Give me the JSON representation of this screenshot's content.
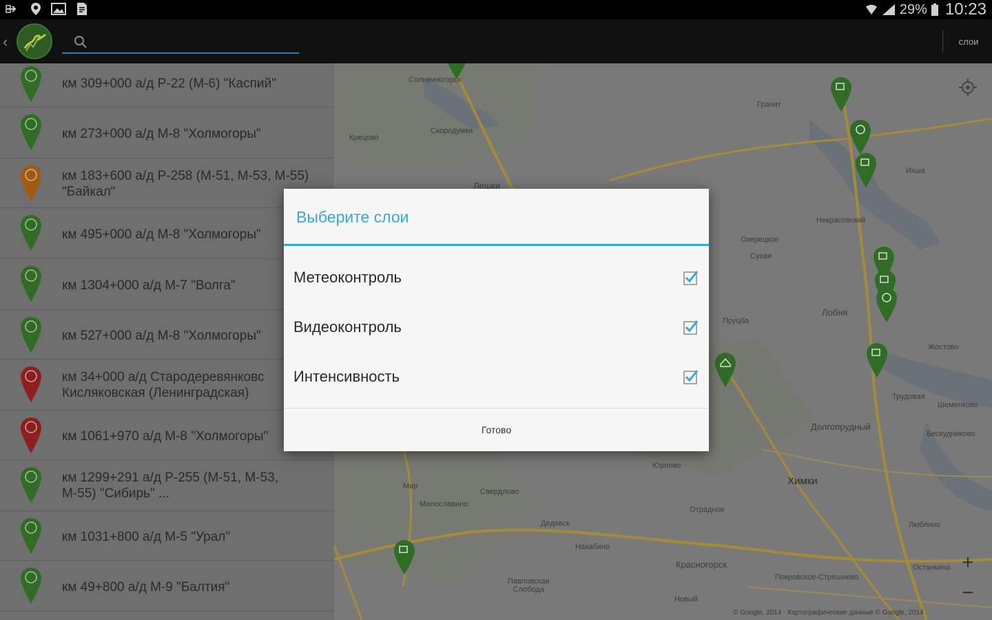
{
  "status_bar": {
    "battery_percent": "29%",
    "time": "10:23"
  },
  "action_bar": {
    "search_placeholder": "",
    "layers_label": "слои"
  },
  "list": {
    "items": [
      {
        "title": "км 309+000 а/д Р-22 (М-6) \"Каспий\"",
        "pin_color": "#2f6d25"
      },
      {
        "title": "км 273+000 а/д М-8 \"Холмогоры\"",
        "pin_color": "#2f6d25"
      },
      {
        "title": "км 183+600 а/д Р-258 (М-51, М-53, М-55)\n\"Байкал\"",
        "pin_color": "#a25a12"
      },
      {
        "title": "км 495+000 а/д М-8 \"Холмогоры\"",
        "pin_color": "#2f6d25"
      },
      {
        "title": "км 1304+000 а/д М-7 \"Волга\"",
        "pin_color": "#2f6d25"
      },
      {
        "title": "км 527+000 а/д М-8 \"Холмогоры\"",
        "pin_color": "#2f6d25"
      },
      {
        "title": "км 34+000 а/д Стародеревянковс\nКисляковская (Ленинградская)",
        "pin_color": "#8e1f1f"
      },
      {
        "title": "км 1061+970 а/д М-8 \"Холмогоры\"",
        "pin_color": "#8e1f1f"
      },
      {
        "title": "км 1299+291 а/д Р-255 (М-51, М-53,\nМ-55) \"Сибирь\"    ...",
        "pin_color": "#2f6d25"
      },
      {
        "title": "км 1031+800 а/д М-5 \"Урал\"",
        "pin_color": "#2f6d25"
      },
      {
        "title": "км 49+800 а/д М-9 \"Балтия\"",
        "pin_color": "#2f6d25"
      }
    ]
  },
  "map": {
    "labels": {
      "solnechnogorsk": "Солнечногорск",
      "granit": "Гранит",
      "kreshchovo": "Крецово",
      "skorodumki": "Скородумки",
      "iksha": "Икша",
      "lyoshki": "Лешки",
      "nekrasovsky": "Некрасовский",
      "ozeretskoe": "Озерецкое",
      "sukhaya": "Сухая",
      "lobnya": "Лобня",
      "pruzhba": "Пруцба",
      "zhostovo": "Жостово",
      "trudovaya": "Трудовая",
      "dolgoprudny": "Долгопрудный",
      "shemenkovo": "Шеменково",
      "beskudnikovo": "Бескудниково",
      "yurlovo": "Юрлово",
      "khimki": "Химки",
      "mir": "Мир",
      "sverdlovo": "Свердлово",
      "miloslavino": "Милославино",
      "dedovsk": "Дедовск",
      "nakhabino": "Нахабино",
      "krasnogorsk": "Красногорск",
      "pavlovskaya_sloboda": "Павловская\nСлобода",
      "novy": "Новый",
      "pokrovskoe": "Покровское-Стрешнево",
      "ostankino": "Останкино",
      "otradnoe": "Отрадное",
      "lyublino": "Люблино"
    },
    "zoom_in": "+",
    "zoom_out": "−",
    "attribution": "© Google, 2014 · Картографические данные © Google, 2014"
  },
  "dialog": {
    "title": "Выберите слои",
    "options": [
      {
        "label": "Метеоконтроль",
        "checked": true
      },
      {
        "label": "Видеоконтроль",
        "checked": true
      },
      {
        "label": "Интенсивность",
        "checked": true
      }
    ],
    "done_label": "Готово"
  },
  "colors": {
    "accent": "#35a9dc",
    "pin_green": "#2f6d25",
    "pin_orange": "#a25a12",
    "pin_red": "#8e1f1f",
    "road_yellow": "#b0902e"
  }
}
